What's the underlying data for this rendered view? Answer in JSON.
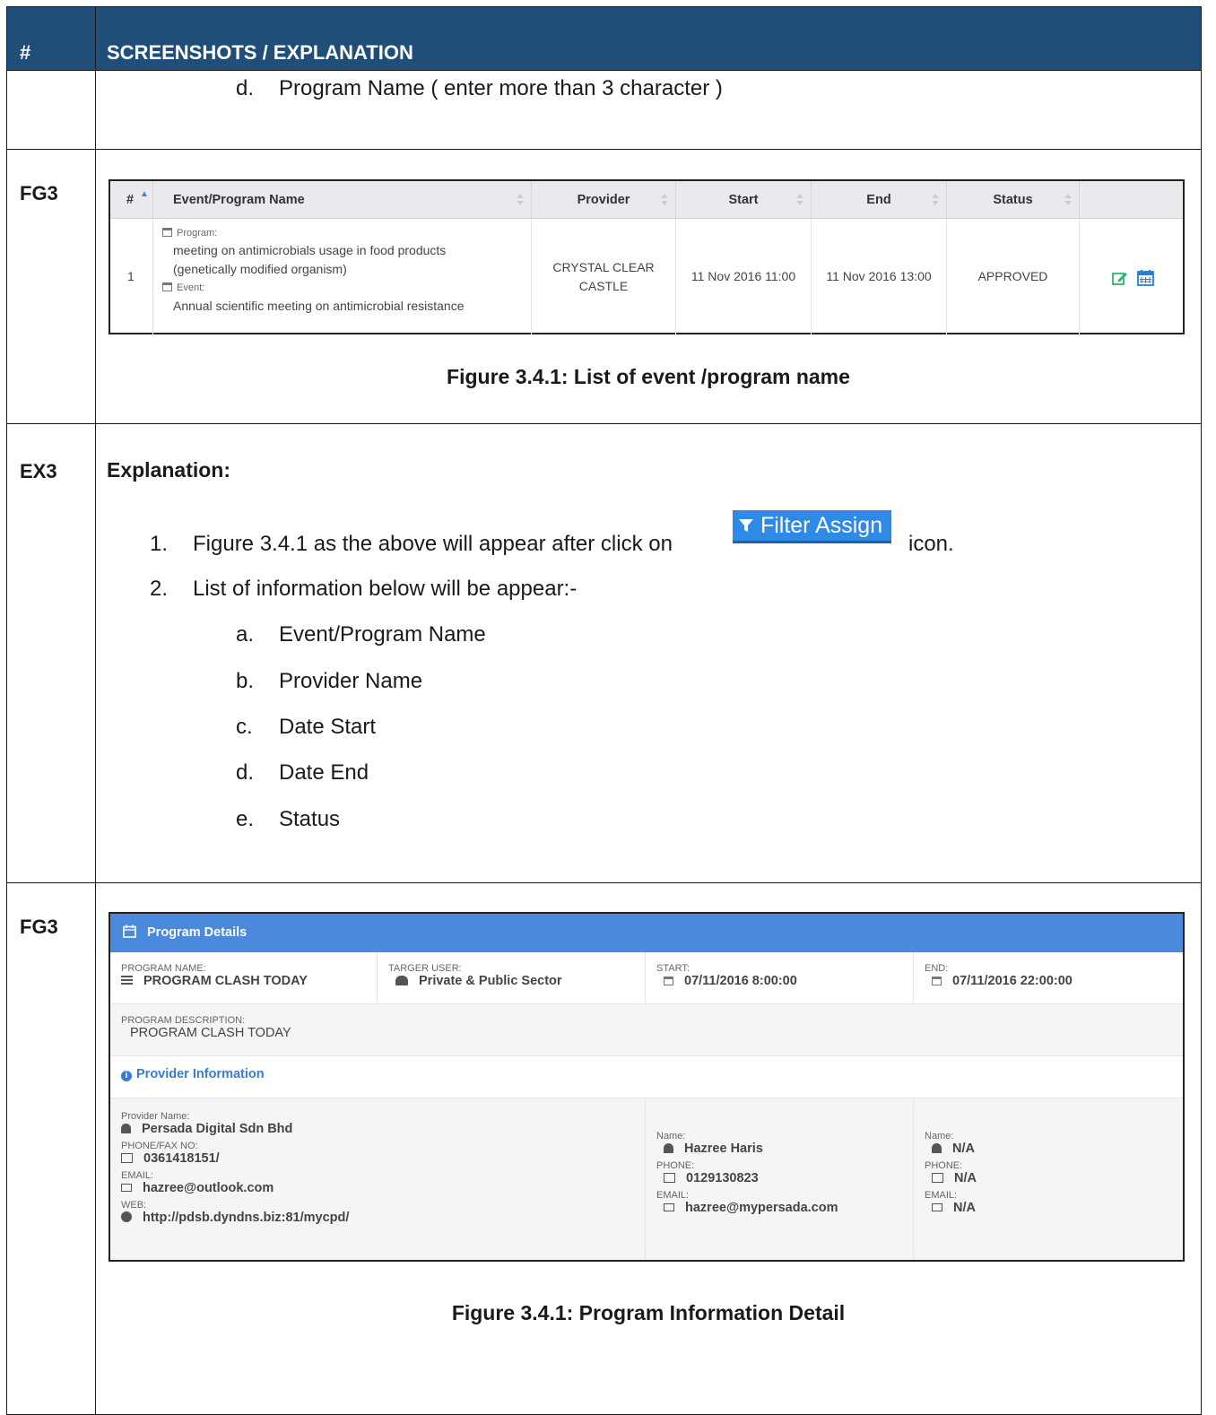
{
  "header": {
    "col_num": "#",
    "col_content": "SCREENSHOTS / EXPLANATION"
  },
  "row0": {
    "text_marker": "d.",
    "text": "Program Name ( enter more than 3 character )"
  },
  "row1": {
    "id": "FG3",
    "table": {
      "columns": [
        "#",
        "Event/Program Name",
        "Provider",
        "Start",
        "End",
        "Status"
      ],
      "row": {
        "num": "1",
        "program_label": "Program:",
        "program_name_1": "meeting on antimicrobials usage in food products",
        "program_name_2": "(genetically modified organism)",
        "event_label": "Event:",
        "event_name": "Annual scientific meeting on antimicrobial resistance",
        "provider_1": "CRYSTAL CLEAR",
        "provider_2": "CASTLE",
        "start": "11 Nov 2016 11:00",
        "end": "11 Nov 2016 13:00",
        "status": "APPROVED"
      }
    },
    "caption": "Figure 3.4.1: List of event /program name"
  },
  "row2": {
    "id": "EX3",
    "heading": "Explanation:",
    "item1_marker": "1.",
    "item1_text": "Figure 3.4.1 as the above will appear after click on",
    "item1_suffix": "icon.",
    "filter_button": "Filter Assign",
    "item2_marker": "2.",
    "item2_text": "List of information below will be appear:-",
    "subitems": [
      {
        "marker": "a.",
        "text": "Event/Program Name"
      },
      {
        "marker": "b.",
        "text": "Provider Name"
      },
      {
        "marker": "c.",
        "text": "Date Start"
      },
      {
        "marker": "d.",
        "text": "Date End"
      },
      {
        "marker": "e.",
        "text": "Status"
      }
    ]
  },
  "row3": {
    "id": "FG3",
    "panel_title": "Program Details",
    "program_name_label": "PROGRAM NAME:",
    "program_name": "PROGRAM CLASH TODAY",
    "target_label": "TARGER USER:",
    "target": "Private & Public Sector",
    "start_label": "START:",
    "start": "07/11/2016 8:00:00",
    "end_label": "END:",
    "end": "07/11/2016 22:00:00",
    "desc_label": "PROGRAM DESCRIPTION:",
    "desc": "PROGRAM CLASH TODAY",
    "provider_section": "Provider Information",
    "provider_name_label": "Provider Name:",
    "provider_name": "Persada Digital Sdn Bhd",
    "phone_fax_label": "PHONE/FAX NO:",
    "phone_fax": "0361418151/",
    "email_label": "EMAIL:",
    "email": "hazree@outlook.com",
    "web_label": "WEB:",
    "web": "http://pdsb.dyndns.biz:81/mycpd/",
    "contact1": {
      "name_label": "Name:",
      "name": "Hazree Haris",
      "phone_label": "PHONE:",
      "phone": "0129130823",
      "email_label": "EMAIL:",
      "email": "hazree@mypersada.com"
    },
    "contact2": {
      "name_label": "Name:",
      "name": "N/A",
      "phone_label": "PHONE:",
      "phone": "N/A",
      "email_label": "EMAIL:",
      "email": "N/A"
    },
    "caption": "Figure 3.4.1: Program Information Detail"
  }
}
